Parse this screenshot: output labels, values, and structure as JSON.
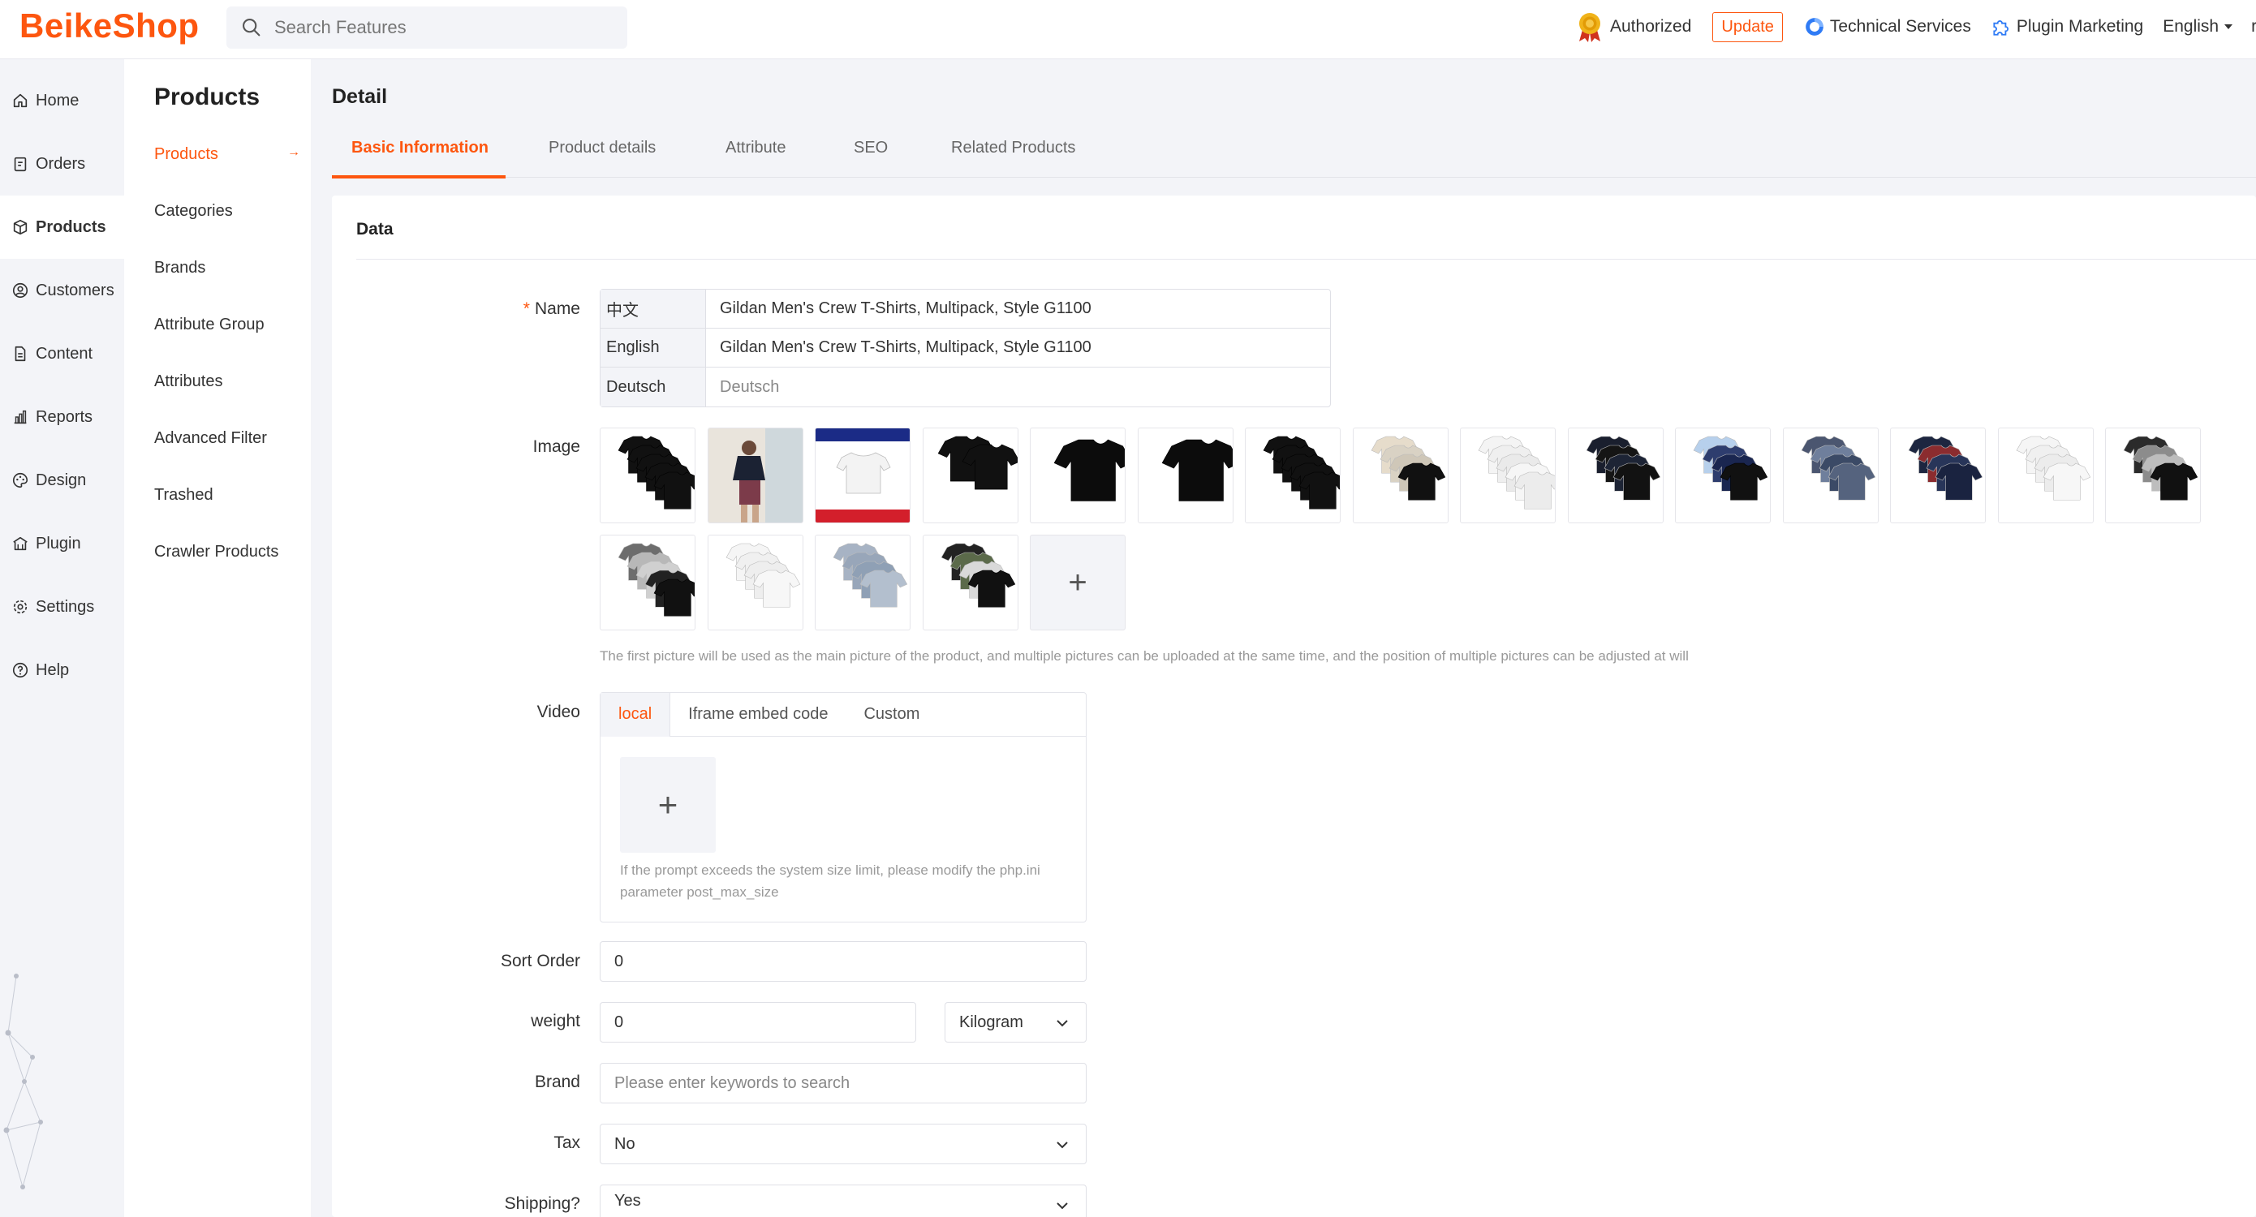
{
  "header": {
    "logo": "BeikeShop",
    "search_placeholder": "Search Features",
    "authorized": "Authorized",
    "update": "Update",
    "technical_services": "Technical Services",
    "plugin_marketing": "Plugin Marketing",
    "language": "English",
    "user_partial": "rc",
    "accent_color": "#fd560f"
  },
  "sidebar": {
    "items": [
      {
        "label": "Home",
        "icon": "home-icon"
      },
      {
        "label": "Orders",
        "icon": "orders-icon"
      },
      {
        "label": "Products",
        "icon": "products-icon"
      },
      {
        "label": "Customers",
        "icon": "customers-icon"
      },
      {
        "label": "Content",
        "icon": "content-icon"
      },
      {
        "label": "Reports",
        "icon": "reports-icon"
      },
      {
        "label": "Design",
        "icon": "design-icon"
      },
      {
        "label": "Plugin",
        "icon": "plugin-icon"
      },
      {
        "label": "Settings",
        "icon": "settings-icon"
      },
      {
        "label": "Help",
        "icon": "help-icon"
      }
    ]
  },
  "submenu": {
    "title": "Products",
    "items": [
      "Products",
      "Categories",
      "Brands",
      "Attribute Group",
      "Attributes",
      "Advanced Filter",
      "Trashed",
      "Crawler Products"
    ],
    "arrow": "→"
  },
  "main": {
    "title": "Detail",
    "tabs": [
      "Basic Information",
      "Product details",
      "Attribute",
      "SEO",
      "Related Products"
    ]
  },
  "form": {
    "section_title": "Data",
    "name_label": "Name",
    "name_required": "*",
    "names": [
      {
        "lang": "中文",
        "value": "Gildan Men's Crew T-Shirts, Multipack, Style G1100"
      },
      {
        "lang": "English",
        "value": "Gildan Men's Crew T-Shirts, Multipack, Style G1100"
      },
      {
        "lang": "Deutsch",
        "placeholder": "Deutsch"
      }
    ],
    "image_label": "Image",
    "image_count": 19,
    "image_hint": "The first picture will be used as the main picture of the product, and multiple pictures can be uploaded at the same time, and the position of multiple pictures can be adjusted at will",
    "add_symbol": "+",
    "video_label": "Video",
    "video_tabs": [
      "local",
      "Iframe embed code",
      "Custom"
    ],
    "video_hint": "If the prompt exceeds the system size limit, please modify the php.ini parameter post_max_size",
    "sort_order_label": "Sort Order",
    "sort_order_value": "0",
    "weight_label": "weight",
    "weight_value": "0",
    "weight_unit": "Kilogram",
    "brand_label": "Brand",
    "brand_placeholder": "Please enter keywords to search",
    "tax_label": "Tax",
    "tax_value": "No",
    "shipping_label": "Shipping?",
    "shipping_value": "Yes"
  }
}
